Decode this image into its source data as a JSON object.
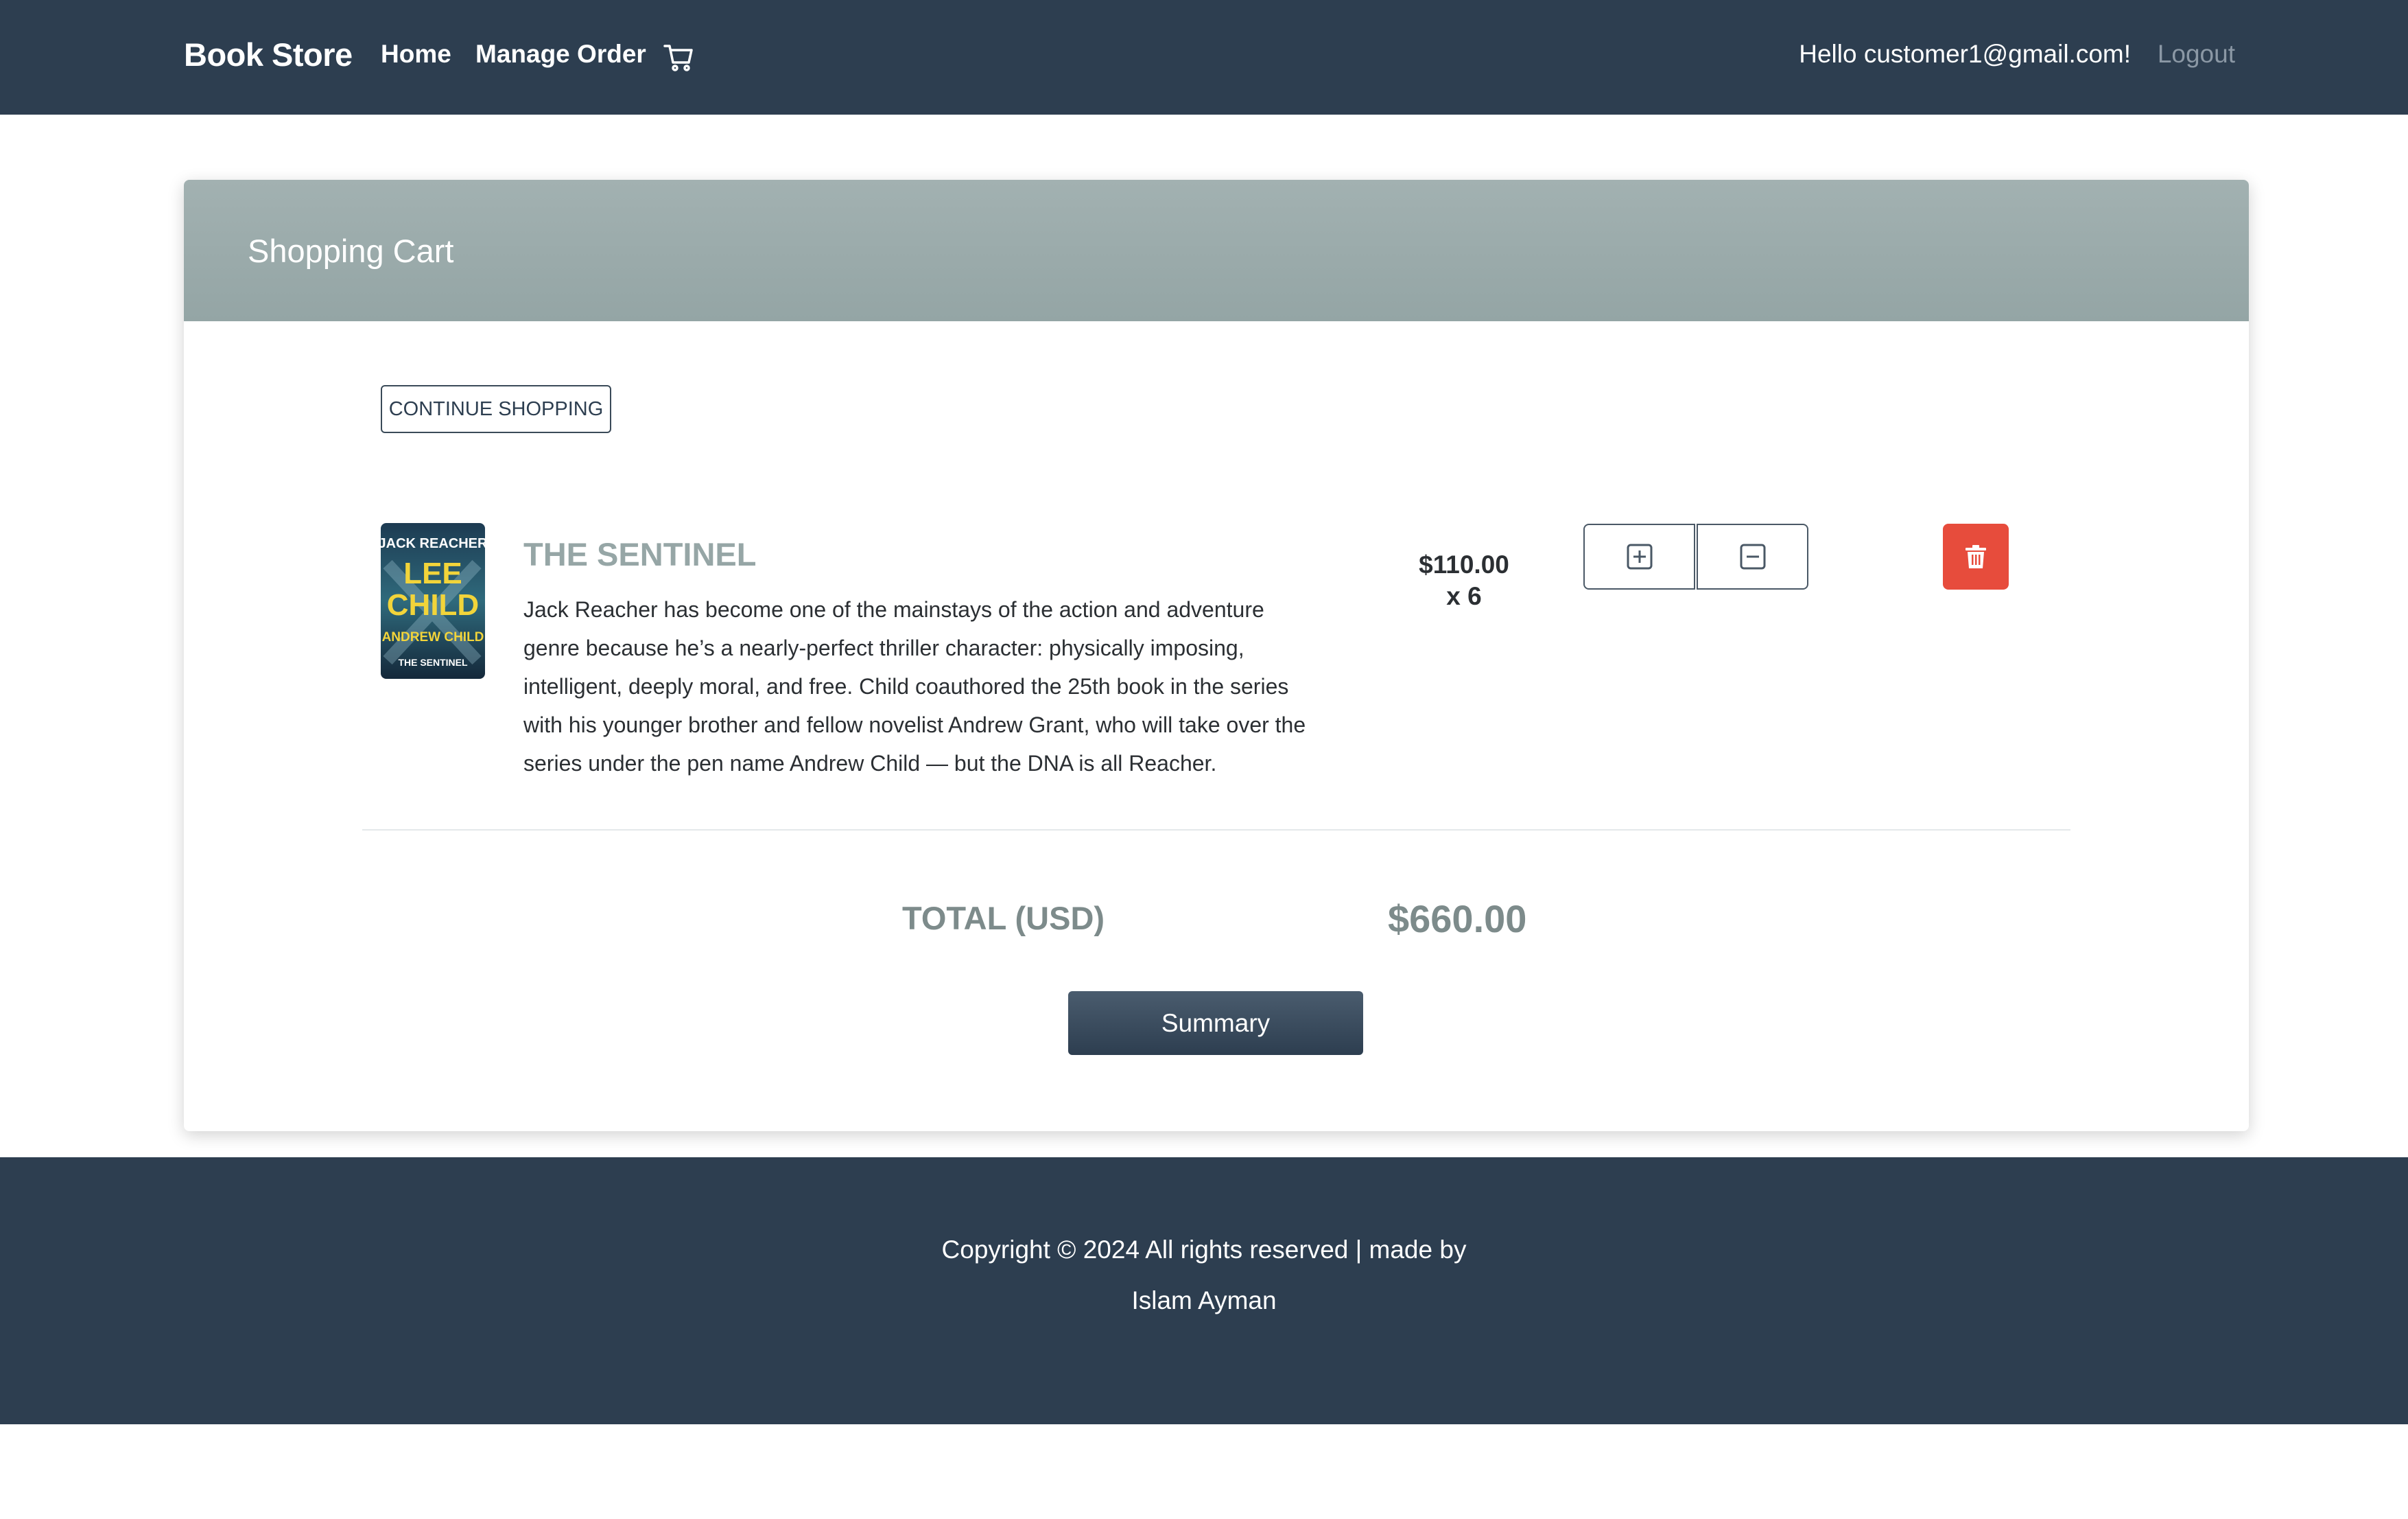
{
  "navbar": {
    "brand": "Book Store",
    "home_label": "Home",
    "manage_order_label": "Manage Order",
    "cart_icon": "cart-icon",
    "greeting": "Hello customer1@gmail.com!",
    "logout_label": "Logout"
  },
  "cart": {
    "title": "Shopping Cart",
    "continue_label": "CONTINUE SHOPPING",
    "items": [
      {
        "cover_icon": "book-cover-image",
        "cover_text": [
          "JACK REACHER",
          "LEE",
          "CHILD",
          "ANDREW CHILD",
          "THE SENTINEL"
        ],
        "title": "THE SENTINEL",
        "description": "Jack Reacher has become one of the mainstays of the action and adventure genre because he’s a nearly-perfect thriller character: physically imposing, intelligent, deeply moral, and free. Child coauthored the 25th book in the series with his younger brother and fellow novelist Andrew Grant, who will take over the series under the pen name Andrew Child — but the DNA is all Reacher.",
        "price": "$110.00",
        "quantity": "x 6"
      }
    ],
    "total_label": "TOTAL (USD)",
    "total_value": "$660.00",
    "summary_label": "Summary"
  },
  "footer": {
    "line1": "Copyright © 2024 All rights reserved | made by",
    "line2": "Islam Ayman"
  },
  "colors": {
    "navbar_bg": "#2d3e50",
    "header_bg": "#9aabab",
    "delete_red": "#e74c3c",
    "muted_text": "#7d8b8b"
  }
}
